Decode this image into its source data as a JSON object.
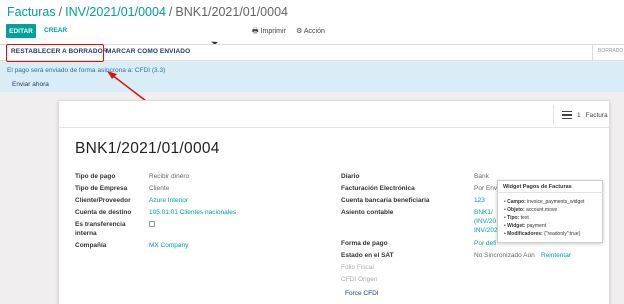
{
  "breadcrumb": {
    "item1": "Facturas",
    "item2": "INV/2021/01/0004",
    "current": "BNK1/2021/01/0004",
    "sep": "/"
  },
  "toolbar": {
    "edit": "EDITAR",
    "create": "CREAR",
    "print": "Imprimir",
    "action": "Acción"
  },
  "statusbar": {
    "reset": "RESTABLECER A BORRADOR",
    "mark_sent": "MARCAR COMO ENVIADO",
    "state": "BORRADO"
  },
  "alert": {
    "text": "El pago será enviado de forma asíncrona a: CFDI (3.3)",
    "send_now": "Enviar ahora"
  },
  "pager": {
    "count": "1",
    "label": "Factura"
  },
  "record": {
    "title": "BNK1/2021/01/0004",
    "left": [
      {
        "label": "Tipo de pago",
        "value": "Recibir dinero"
      },
      {
        "label": "Tipo de Empresa",
        "value": "Cliente"
      },
      {
        "label": "Cliente/Proveedor",
        "value": "Azure Interior"
      },
      {
        "label": "Cuenta de destino",
        "value": "105.01.01 Clientes nacionales"
      },
      {
        "label1": "Es transferencia",
        "label2": "interna"
      },
      {
        "label": "Compañía",
        "value": "MX Company"
      }
    ],
    "right": [
      {
        "label": "Diario",
        "value": "Bank"
      },
      {
        "label": "Facturación Electrónica",
        "value": "Por Envi"
      },
      {
        "label": "Cuenta bancaria beneficiaria",
        "value": "123"
      },
      {
        "label": "Asiento contable",
        "value1": "BNK1/",
        "value2": "(INV/20",
        "value3": "INV/202"
      },
      {
        "label": "Forma de pago",
        "value": "Por defi"
      },
      {
        "label": "Estado en el SAT",
        "value": "No Sincronizado Aún",
        "action": "Reintentar"
      },
      {
        "label": "Folio Fiscal"
      },
      {
        "label": "CFDI Origen"
      }
    ],
    "force_cfdi": "Force CFDI"
  },
  "tooltip": {
    "title": "Widget Pagos de Facturas",
    "rows": [
      {
        "key": "Campo:",
        "value": "invoice_payments_widget"
      },
      {
        "key": "Objeto:",
        "value": "account.move"
      },
      {
        "key": "Tipo:",
        "value": "text"
      },
      {
        "key": "Widget:",
        "value": "payment"
      },
      {
        "key": "Modificadores:",
        "value": "{\"readonly\":true}"
      }
    ]
  },
  "colors": {
    "accent": "#00a09d",
    "highlight": "#dd1111",
    "alert_bg": "#d9edf7"
  }
}
